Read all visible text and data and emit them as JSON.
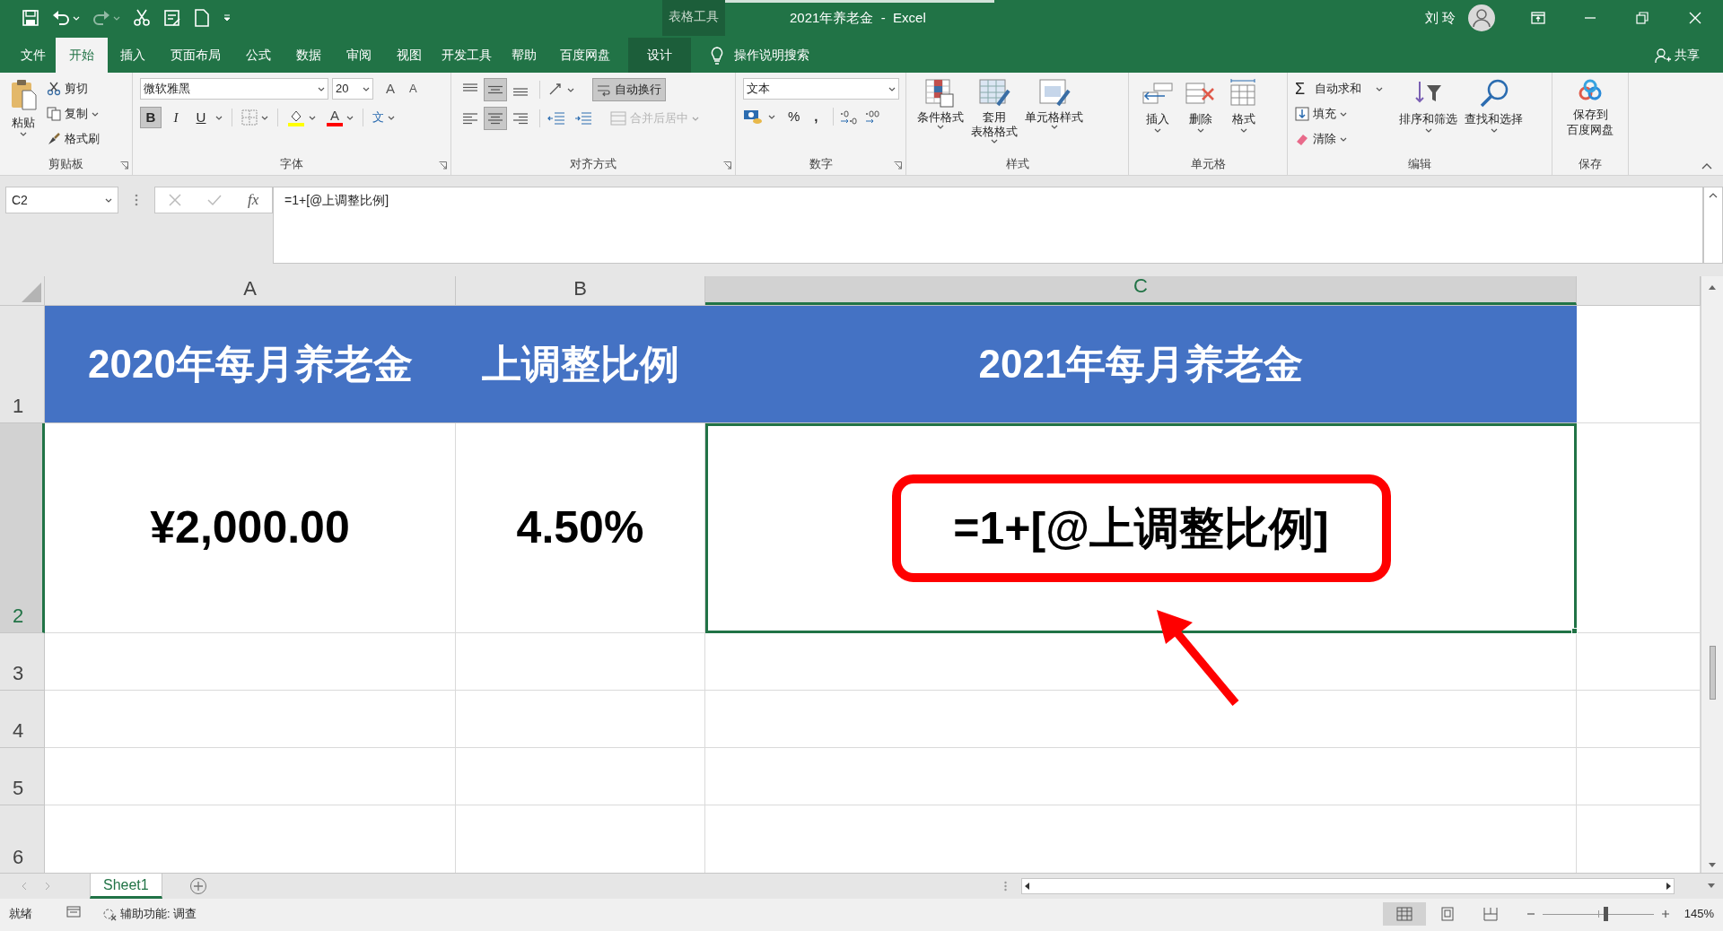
{
  "title_bar": {
    "context_tab": "表格工具",
    "title": "2021年养老金  -  Excel",
    "user": "刘 玲"
  },
  "tabs": [
    {
      "label": "文件",
      "selected": false
    },
    {
      "label": "开始",
      "selected": true
    },
    {
      "label": "插入",
      "selected": false
    },
    {
      "label": "页面布局",
      "selected": false
    },
    {
      "label": "公式",
      "selected": false
    },
    {
      "label": "数据",
      "selected": false
    },
    {
      "label": "审阅",
      "selected": false
    },
    {
      "label": "视图",
      "selected": false
    },
    {
      "label": "开发工具",
      "selected": false
    },
    {
      "label": "帮助",
      "selected": false
    },
    {
      "label": "百度网盘",
      "selected": false
    },
    {
      "label": "设计",
      "selected": false,
      "kind": "context"
    }
  ],
  "tell_me": "操作说明搜索",
  "share": "共享",
  "clipboard": {
    "label": "剪贴板",
    "paste": "粘贴",
    "cut": "剪切",
    "copy": "复制",
    "format_painter": "格式刷"
  },
  "font": {
    "label": "字体",
    "name": "微软雅黑",
    "size": "20",
    "grow": "A",
    "shrink": "A",
    "color_glyph": "A",
    "phonetic": "文",
    "styles": [
      {
        "label": "B",
        "kind": "bold",
        "on": true
      },
      {
        "label": "I",
        "kind": "italic",
        "on": false
      },
      {
        "label": "U",
        "kind": "underline",
        "on": false
      }
    ]
  },
  "alignment": {
    "label": "对齐方式",
    "wrap_text": "自动换行",
    "wrap_on": true,
    "merge_center": "合并后居中",
    "vertical": [
      {
        "kind": "top",
        "selected": false
      },
      {
        "kind": "middle",
        "selected": true
      },
      {
        "kind": "bottom",
        "selected": false
      }
    ],
    "horizontal": [
      {
        "kind": "left",
        "selected": false
      },
      {
        "kind": "center",
        "selected": true
      },
      {
        "kind": "right",
        "selected": false
      }
    ]
  },
  "number": {
    "label": "数字",
    "format": "文本",
    "percent": "%",
    "comma": ","
  },
  "styles": {
    "label": "样式",
    "items": [
      [
        "条件格式"
      ],
      [
        "套用",
        "表格格式"
      ],
      [
        "单元格样式"
      ]
    ]
  },
  "cells": {
    "label": "单元格",
    "items": [
      "插入",
      "删除",
      "格式"
    ]
  },
  "editing": {
    "label": "编辑",
    "sigma": "Σ",
    "autosum": "自动求和",
    "fill": "填充",
    "clear": "清除",
    "sort": "排序和筛选",
    "find": "查找和选择"
  },
  "save": {
    "label": "保存",
    "button": [
      "保存到",
      "百度网盘"
    ]
  },
  "formula_bar": {
    "name_box": "C2",
    "fx": "fx",
    "formula": "=1+[@上调整比例]"
  },
  "sheet": {
    "columns": [
      {
        "label": "A",
        "selected": false
      },
      {
        "label": "B",
        "selected": false
      },
      {
        "label": "C",
        "selected": true
      }
    ],
    "rows": [
      {
        "label": "1",
        "selected": false,
        "kind": "header",
        "cells": [
          "2020年每月养老金",
          "上调整比例",
          "2021年每月养老金"
        ]
      },
      {
        "label": "2",
        "selected": true,
        "kind": "data",
        "cells": [
          "¥2,000.00",
          "4.50%",
          {
            "text": "=1+[@上调整比例]",
            "active": true,
            "highlighted": true
          }
        ]
      },
      {
        "label": "3",
        "selected": false
      },
      {
        "label": "4",
        "selected": false
      },
      {
        "label": "5",
        "selected": false
      },
      {
        "label": "6",
        "selected": false
      }
    ]
  },
  "sheet_tabs": [
    {
      "label": "Sheet1",
      "selected": true
    }
  ],
  "status_bar": {
    "ready": "就绪",
    "accessibility": "辅助功能: 调查",
    "views": [
      {
        "kind": "normal",
        "selected": true
      },
      {
        "kind": "page_layout",
        "selected": false
      },
      {
        "kind": "page_break",
        "selected": false
      }
    ],
    "zoom_slider": {
      "level": 0.57
    },
    "zoom": "145%"
  }
}
